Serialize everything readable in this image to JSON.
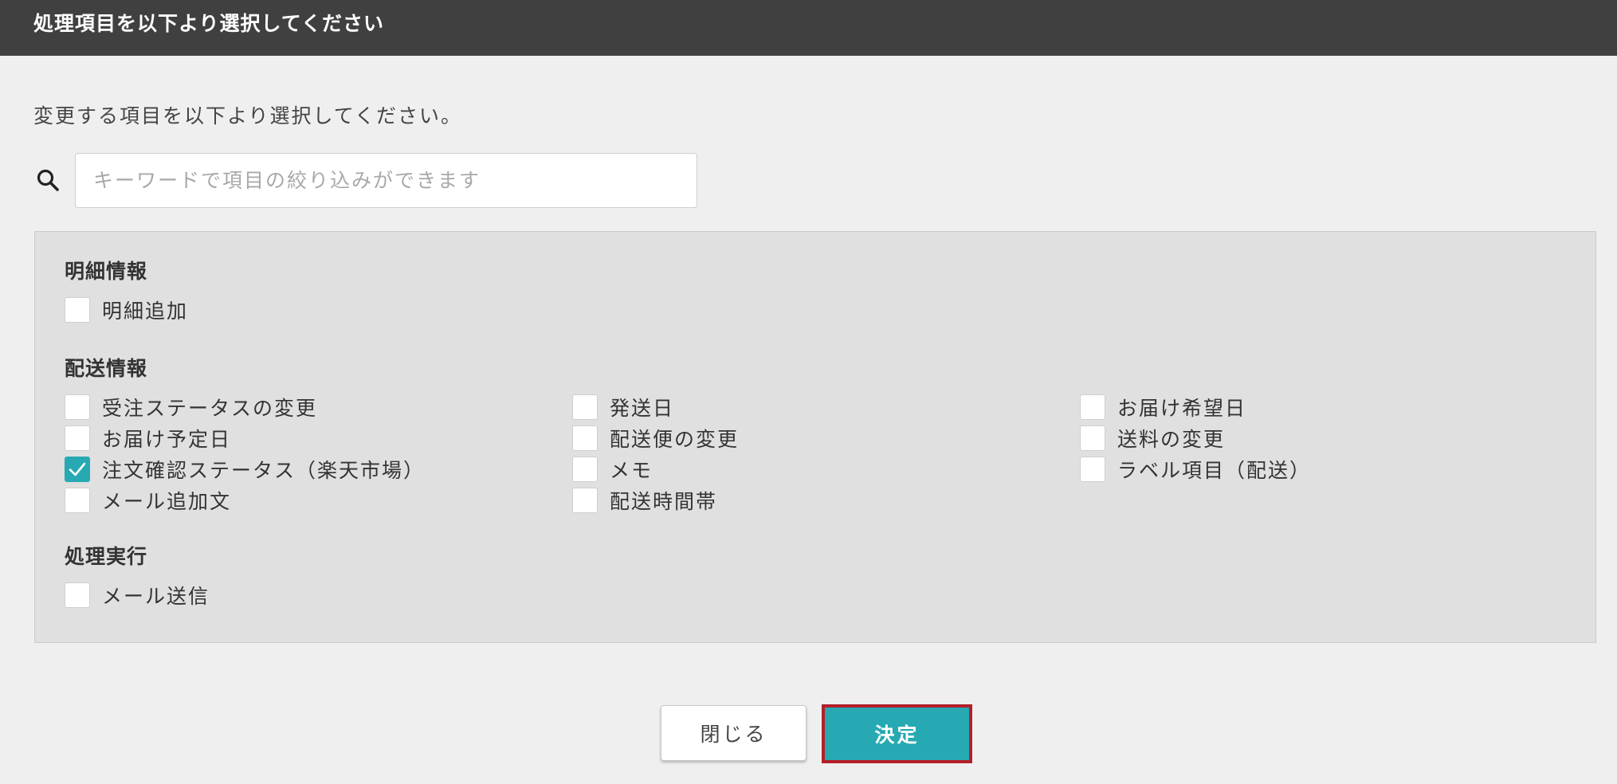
{
  "dialog": {
    "title": "処理項目を以下より選択してください",
    "instruction": "変更する項目を以下より選択してください。"
  },
  "search": {
    "icon": "search-icon",
    "placeholder": "キーワードで項目の絞り込みができます",
    "value": ""
  },
  "sections": [
    {
      "title": "明細情報",
      "options": [
        {
          "label": "明細追加",
          "checked": false
        }
      ]
    },
    {
      "title": "配送情報",
      "options": [
        {
          "label": "受注ステータスの変更",
          "checked": false
        },
        {
          "label": "お届け予定日",
          "checked": false
        },
        {
          "label": "注文確認ステータス（楽天市場）",
          "checked": true
        },
        {
          "label": "メール追加文",
          "checked": false
        },
        {
          "label": "発送日",
          "checked": false
        },
        {
          "label": "配送便の変更",
          "checked": false
        },
        {
          "label": "メモ",
          "checked": false
        },
        {
          "label": "配送時間帯",
          "checked": false
        },
        {
          "label": "お届け希望日",
          "checked": false
        },
        {
          "label": "送料の変更",
          "checked": false
        },
        {
          "label": "ラベル項目（配送）",
          "checked": false
        }
      ]
    },
    {
      "title": "処理実行",
      "options": [
        {
          "label": "メール送信",
          "checked": false
        }
      ]
    }
  ],
  "buttons": {
    "close_label": "閉じる",
    "confirm_label": "決定"
  },
  "colors": {
    "accent": "#26a9b2",
    "titlebar": "#404040",
    "highlight_border": "#b3202a"
  }
}
